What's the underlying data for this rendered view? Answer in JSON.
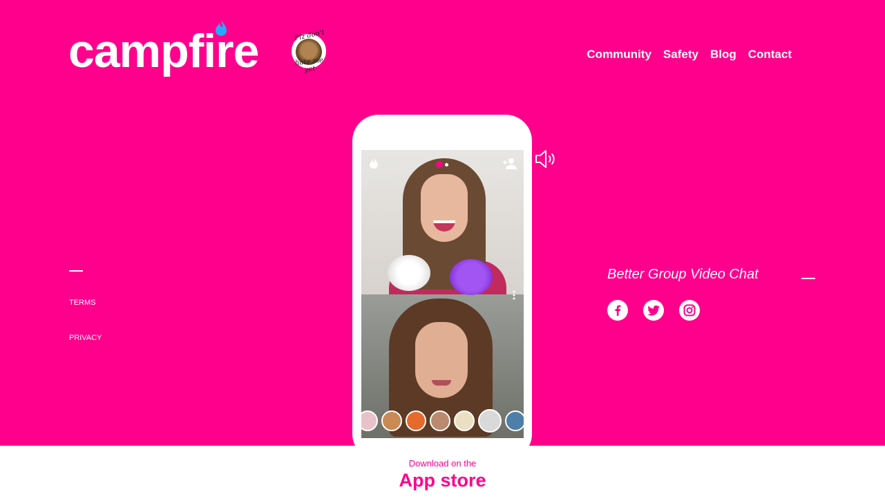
{
  "header": {
    "logo_text": "campfire",
    "badge": {
      "line1": "Plz don't",
      "line2": "hate me yet"
    },
    "nav": [
      "Community",
      "Safety",
      "Blog",
      "Contact"
    ]
  },
  "footer_links": {
    "terms": "TERMS",
    "privacy": "PRIVACY"
  },
  "tagline": "Better Group Video Chat",
  "socials": [
    "facebook-icon",
    "twitter-icon",
    "instagram-icon"
  ],
  "app_store": {
    "pre": "Download on the",
    "label": "App store"
  },
  "colors": {
    "brand": "#ff008c",
    "flame": "#2aa7ff",
    "white": "#ffffff"
  }
}
